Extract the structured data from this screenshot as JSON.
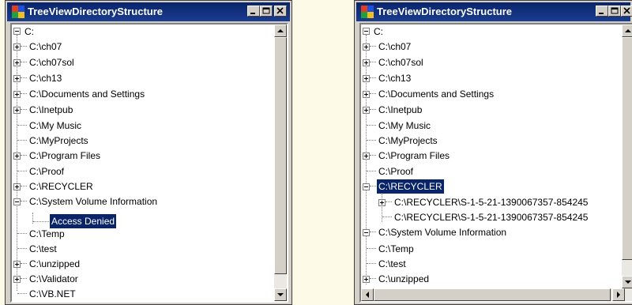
{
  "window_left": {
    "title": "TreeViewDirectoryStructure",
    "root": "C:",
    "items": [
      "C:\\ch07",
      "C:\\ch07sol",
      "C:\\ch13",
      "C:\\Documents and Settings",
      "C:\\Inetpub",
      "C:\\My Music",
      "C:\\MyProjects",
      "C:\\Program Files",
      "C:\\Proof",
      "C:\\RECYCLER",
      "C:\\System Volume Information",
      "C:\\Temp",
      "C:\\test",
      "C:\\unzipped",
      "C:\\Validator",
      "C:\\VB.NET"
    ],
    "child": "Access Denied"
  },
  "window_right": {
    "title": "TreeViewDirectoryStructure",
    "root": "C:",
    "items": [
      "C:\\ch07",
      "C:\\ch07sol",
      "C:\\ch13",
      "C:\\Documents and Settings",
      "C:\\Inetpub",
      "C:\\My Music",
      "C:\\MyProjects",
      "C:\\Program Files",
      "C:\\Proof",
      "C:\\RECYCLER",
      "C:\\System Volume Information",
      "C:\\Temp",
      "C:\\test",
      "C:\\unzipped"
    ],
    "children": [
      "C:\\RECYCLER\\S-1-5-21-1390067357-854245",
      "C:\\RECYCLER\\S-1-5-21-1390067357-854245"
    ]
  }
}
